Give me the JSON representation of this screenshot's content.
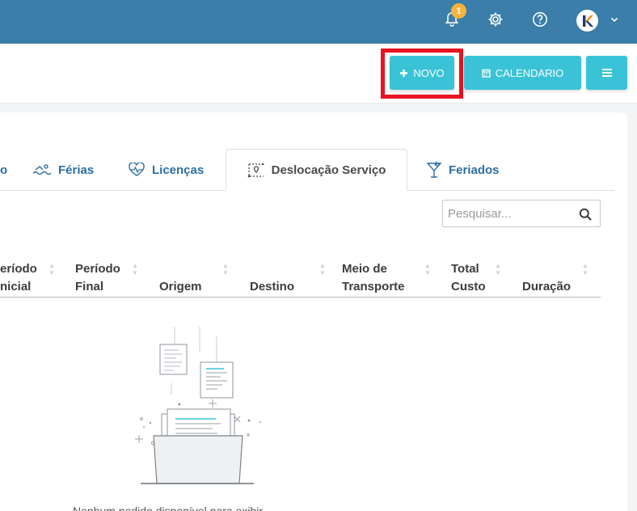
{
  "topbar": {
    "background": "#3a7ea9",
    "notifications_count": "1",
    "icons": [
      "bell-icon",
      "gear-icon",
      "help-icon",
      "user-avatar",
      "chevron-down-icon"
    ]
  },
  "actions": {
    "novo_label": "NOVO",
    "calendario_label": "CALENDARIO",
    "accent": "#3ac3d6",
    "highlight_color": "#e8131f"
  },
  "tabs": [
    {
      "label": "Férias",
      "icon": "swimmer-icon",
      "active": false
    },
    {
      "label": "Licenças",
      "icon": "heart-pulse-icon",
      "active": false
    },
    {
      "label": "Deslocação Serviço",
      "icon": "route-icon",
      "active": true
    },
    {
      "label": "Feriados",
      "icon": "cocktail-icon",
      "active": false
    }
  ],
  "partial_tab_char": "o",
  "search": {
    "placeholder": "Pesquisar..."
  },
  "table": {
    "columns": [
      {
        "line1": "eríodo",
        "line2": "nicial"
      },
      {
        "line1": "Período",
        "line2": "Final"
      },
      {
        "line1": "",
        "line2": "Origem"
      },
      {
        "line1": "",
        "line2": "Destino"
      },
      {
        "line1": "Meio de",
        "line2": "Transporte"
      },
      {
        "line1": "Total",
        "line2": "Custo"
      },
      {
        "line1": "",
        "line2": "Duração"
      }
    ]
  },
  "empty": {
    "text": "Nenhum pedido disponível para exibir"
  }
}
